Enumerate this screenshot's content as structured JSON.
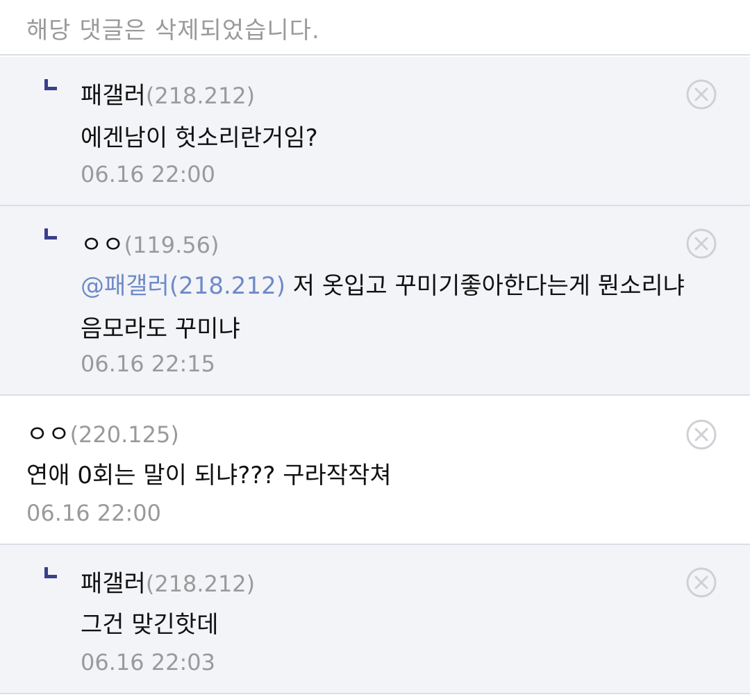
{
  "deleted_notice": "해당 댓글은 삭제되었습니다.",
  "comments": [
    {
      "author": "패갤러",
      "ip": "(218.212)",
      "body": "에겐남이 헛소리란거임?",
      "date": "06.16 22:00"
    },
    {
      "author": "ㅇㅇ",
      "ip": "(119.56)",
      "mention": "@패갤러(218.212)",
      "body_line1": " 저 옷입고 꾸미기좋아한다는게 뭔소리냐",
      "body_line2": "음모라도 꾸미냐",
      "date": "06.16 22:15"
    },
    {
      "author": "ㅇㅇ",
      "ip": "(220.125)",
      "body": "연애 0회는 말이 되냐??? 구라작작쳐",
      "date": "06.16 22:00"
    },
    {
      "author": "패갤러",
      "ip": "(218.212)",
      "body": "그건 맞긴핫데",
      "date": "06.16 22:03"
    }
  ],
  "icons": {
    "delete": "close-circle-icon",
    "reply": "reply-corner-icon"
  },
  "colors": {
    "reply_bg": "#f3f4f8",
    "reply_mark": "#3a3f8a",
    "mention": "#6f8ac7",
    "muted": "#9a9a9a",
    "divider": "#dcdde6"
  }
}
